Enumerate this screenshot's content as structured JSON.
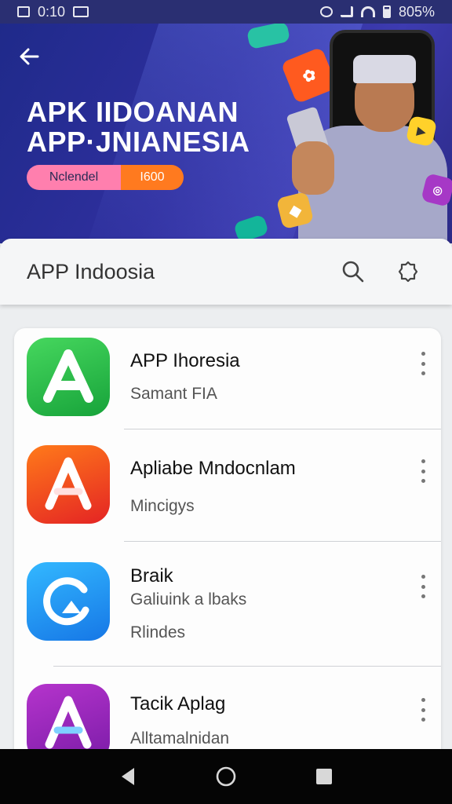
{
  "status_bar": {
    "time": "0:10",
    "battery": "805%"
  },
  "banner": {
    "title_line1": "APK IIDOANAN",
    "title_line2": "APP·JNIANESIA",
    "pill_left": "Nclendel",
    "pill_right": "I600"
  },
  "search": {
    "text": "APP Indoosia"
  },
  "apps": [
    {
      "title": "APP Ihoresia",
      "subtitle": "Samant FIA",
      "subtitle2": "",
      "color_top": "#3fd35a",
      "color_bottom": "#18a63c"
    },
    {
      "title": "Apliabe Mndocnlam",
      "subtitle": "Mincigys",
      "subtitle2": "",
      "color_top": "#ff6a1a",
      "color_bottom": "#e52424"
    },
    {
      "title": "Braik",
      "subtitle": "Galiuink a lbaks",
      "subtitle2": "Rlindes",
      "color_top": "#2bb0ff",
      "color_bottom": "#1a7fe8"
    },
    {
      "title": "Tacik Aplag",
      "subtitle": "Alltamalnidan",
      "subtitle2": "",
      "color_top": "#b234c9",
      "color_bottom": "#7a1da6"
    }
  ]
}
